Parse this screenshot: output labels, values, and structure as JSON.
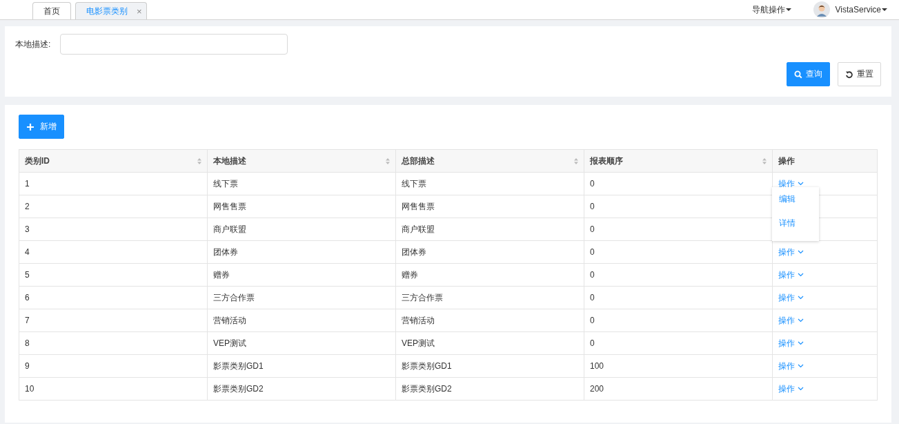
{
  "tabs": [
    {
      "label": "首页",
      "selected": false
    },
    {
      "label": "电影票类别",
      "selected": true,
      "close": "×"
    }
  ],
  "nav_menu": "导航操作",
  "user": "VistaService",
  "search": {
    "label": "本地描述:"
  },
  "buttons": {
    "query": "查询",
    "reset": "重置",
    "add": "新增"
  },
  "table": {
    "columns": [
      {
        "label": "类别ID",
        "sortable": true
      },
      {
        "label": "本地描述",
        "sortable": true
      },
      {
        "label": "总部描述",
        "sortable": true
      },
      {
        "label": "报表顺序",
        "sortable": true
      },
      {
        "label": "操作",
        "sortable": false
      }
    ],
    "rows": [
      {
        "cells": [
          "1",
          "线下票",
          "线下票",
          "0"
        ],
        "action": "操作"
      },
      {
        "cells": [
          "2",
          "网售售票",
          "网售售票",
          "0"
        ]
      },
      {
        "cells": [
          "3",
          "商户联盟",
          "商户联盟",
          "0"
        ]
      },
      {
        "cells": [
          "4",
          "团体券",
          "团体券",
          "0"
        ],
        "action": "操作"
      },
      {
        "cells": [
          "5",
          "赠券",
          "赠券",
          "0"
        ],
        "action": "操作"
      },
      {
        "cells": [
          "6",
          "三方合作票",
          "三方合作票",
          "0"
        ],
        "action": "操作"
      },
      {
        "cells": [
          "7",
          "营销活动",
          "营销活动",
          "0"
        ],
        "action": "操作"
      },
      {
        "cells": [
          "8",
          "VEP测试",
          "VEP测试",
          "0"
        ],
        "action": "操作"
      },
      {
        "cells": [
          "9",
          "影票类别GD1",
          "影票类别GD1",
          "100"
        ],
        "action": "操作"
      },
      {
        "cells": [
          "10",
          "影票类别GD2",
          "影票类别GD2",
          "200"
        ],
        "action": "操作"
      }
    ]
  },
  "action_menu": [
    "编辑",
    "详情"
  ]
}
